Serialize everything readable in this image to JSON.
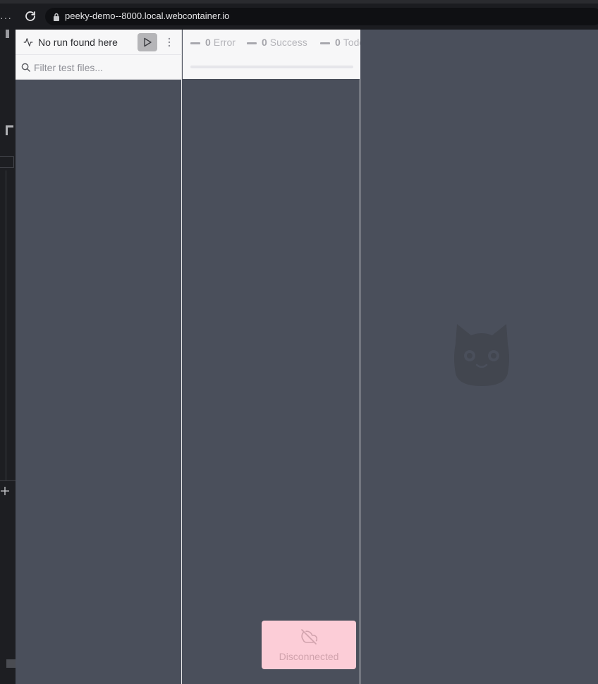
{
  "browser": {
    "menu_glyph": "···",
    "url": "peeky-demo--8000.local.webcontainer.io"
  },
  "sidebar": {
    "title": "No run found here",
    "filter_placeholder": "Filter test files..."
  },
  "summary": {
    "error": {
      "count": "0",
      "label": "Error"
    },
    "success": {
      "count": "0",
      "label": "Success"
    },
    "todo": {
      "count": "0",
      "label": "Todo"
    }
  },
  "toast": {
    "label": "Disconnected"
  },
  "icons": {
    "reload": "reload-icon",
    "lock": "lock-icon",
    "activity": "activity-icon",
    "play": "play-icon",
    "more": "more-vertical-icon",
    "search": "search-icon",
    "cloud_off": "cloud-off-icon",
    "logo": "cat-logo-icon",
    "plus": "plus-icon"
  },
  "colors": {
    "app_background": "#4a4f5b",
    "panel_header": "#f7f7f8",
    "toast_background": "#fccdd7",
    "toast_text": "#d1a3ad"
  }
}
